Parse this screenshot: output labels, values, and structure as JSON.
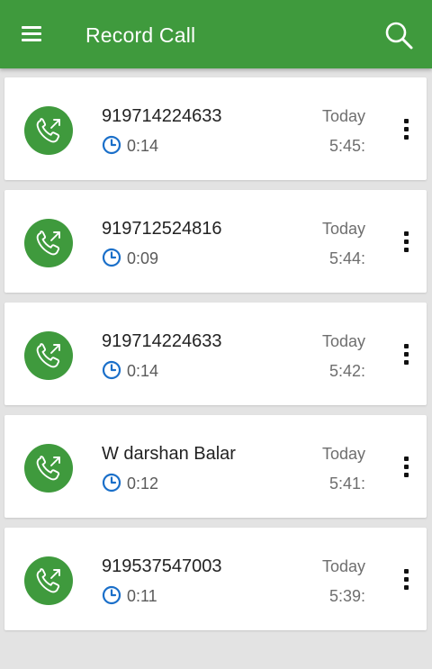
{
  "app_bar": {
    "title": "Record Call",
    "menu_icon": "hamburger-menu-icon",
    "search_icon": "search-icon",
    "color": "#3f9a3d"
  },
  "recordings": [
    {
      "caller": "919714224633",
      "duration": "0:14",
      "day": "Today",
      "time": "5:45:"
    },
    {
      "caller": "919712524816",
      "duration": "0:09",
      "day": "Today",
      "time": "5:44:"
    },
    {
      "caller": "919714224633",
      "duration": "0:14",
      "day": "Today",
      "time": "5:42:"
    },
    {
      "caller": "W darshan Balar",
      "duration": "0:12",
      "day": "Today",
      "time": "5:41:"
    },
    {
      "caller": "919537547003",
      "duration": "0:11",
      "day": "Today",
      "time": "5:39:"
    }
  ],
  "icons": {
    "call_type": "outgoing-call-icon",
    "duration": "clock-icon",
    "row_menu": "more-vertical-icon"
  },
  "colors": {
    "accent": "#3f9a3d",
    "clock": "#1a6fc9"
  }
}
